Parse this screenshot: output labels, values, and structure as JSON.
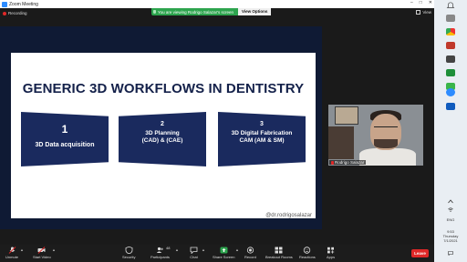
{
  "window": {
    "title": "Zoom Meeting"
  },
  "recording": {
    "label": "Recording"
  },
  "share_banner": {
    "text": "You are viewing Rodrigo Salazar's screen",
    "view_options": "View Options"
  },
  "view": {
    "label": "View"
  },
  "slide": {
    "title": "GENERIC 3D WORKFLOWS IN DENTISTRY",
    "steps": [
      {
        "number": "1",
        "label": "3D Data acquisition"
      },
      {
        "number": "2",
        "label_line1": "3D Planning",
        "label_line2": "(CAD) & (CAE)"
      },
      {
        "number": "3",
        "label_line1": "3D Digital Fabrication",
        "label_line2": "CAM (AM & SM)"
      }
    ],
    "handle": "@dr.rodrigosalazar"
  },
  "video": {
    "name": "Rodrigo Salazar"
  },
  "toolbar": {
    "unmute": "Unmute",
    "start_video": "Start Video",
    "security": "Security",
    "participants": "Participants",
    "participants_count": "48",
    "chat": "Chat",
    "share_screen": "Share Screen",
    "record": "Record",
    "breakout_rooms": "Breakout Rooms",
    "reactions": "Reactions",
    "apps": "Apps",
    "leave": "Leave"
  },
  "taskbar": {
    "lang": "ENG",
    "time": "9:53",
    "day": "Thursday",
    "date": "7/1/2021"
  },
  "colors": {
    "accent_green": "#2da44e",
    "leave_red": "#e02828",
    "slide_navy": "#1a2a5e",
    "slide_title": "#14214a"
  }
}
